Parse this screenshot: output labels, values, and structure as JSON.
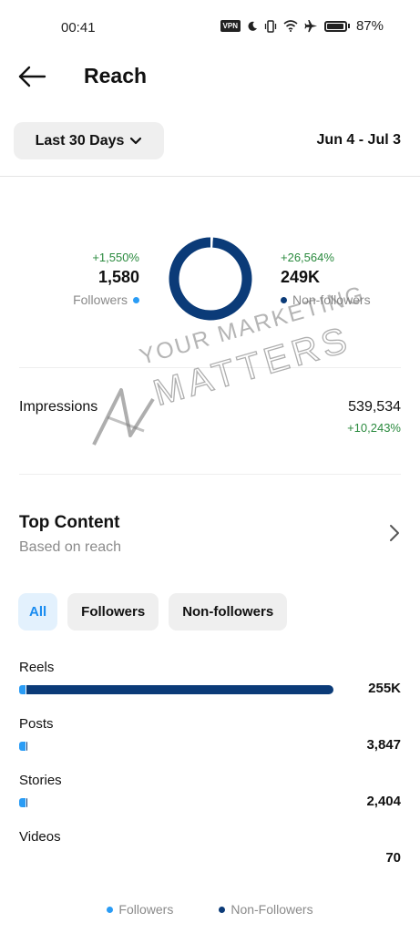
{
  "status_bar": {
    "time": "00:41",
    "vpn_label": "VPN",
    "battery_percent": "87%",
    "icons": [
      "vpn-icon",
      "moon-icon",
      "vibrate-icon",
      "wifi-icon",
      "airplane-icon",
      "battery-icon"
    ]
  },
  "header": {
    "title": "Reach",
    "back_icon": "arrow-left-icon"
  },
  "filter": {
    "range_label": "Last 30 Days",
    "date_range": "Jun 4 - Jul 3"
  },
  "reach": {
    "followers": {
      "change": "+1,550%",
      "value": "1,580",
      "label": "Followers"
    },
    "non_followers": {
      "change": "+26,564%",
      "value": "249K",
      "label": "Non-followers"
    },
    "donut": {
      "followers_share": 0.0063,
      "non_followers_share": 0.9937
    }
  },
  "impressions": {
    "label": "Impressions",
    "value": "539,534",
    "change": "+10,243%"
  },
  "watermark": {
    "line1": "YOUR MARKETING",
    "line2": "MATTERS"
  },
  "top_content": {
    "title": "Top Content",
    "subtitle": "Based on reach",
    "tabs": [
      {
        "label": "All",
        "active": true
      },
      {
        "label": "Followers",
        "active": false
      },
      {
        "label": "Non-followers",
        "active": false
      }
    ],
    "items": [
      {
        "label": "Reels",
        "value": "255K",
        "fill": 1.0,
        "followers_fill": 0.02
      },
      {
        "label": "Posts",
        "value": "3,847",
        "fill": 0.015,
        "followers_fill": 0.008
      },
      {
        "label": "Stories",
        "value": "2,404",
        "fill": 0.012,
        "followers_fill": 0.006
      },
      {
        "label": "Videos",
        "value": "70",
        "fill": 0.0,
        "followers_fill": 0.0
      }
    ],
    "legend": {
      "followers": "Followers",
      "non_followers": "Non-Followers"
    }
  },
  "colors": {
    "followers": "#2a9cf5",
    "non_followers": "#0b3b78",
    "positive_change": "#2a8a3e",
    "active_tab_text": "#1a8cf0",
    "active_tab_bg": "#e3f1fd"
  }
}
